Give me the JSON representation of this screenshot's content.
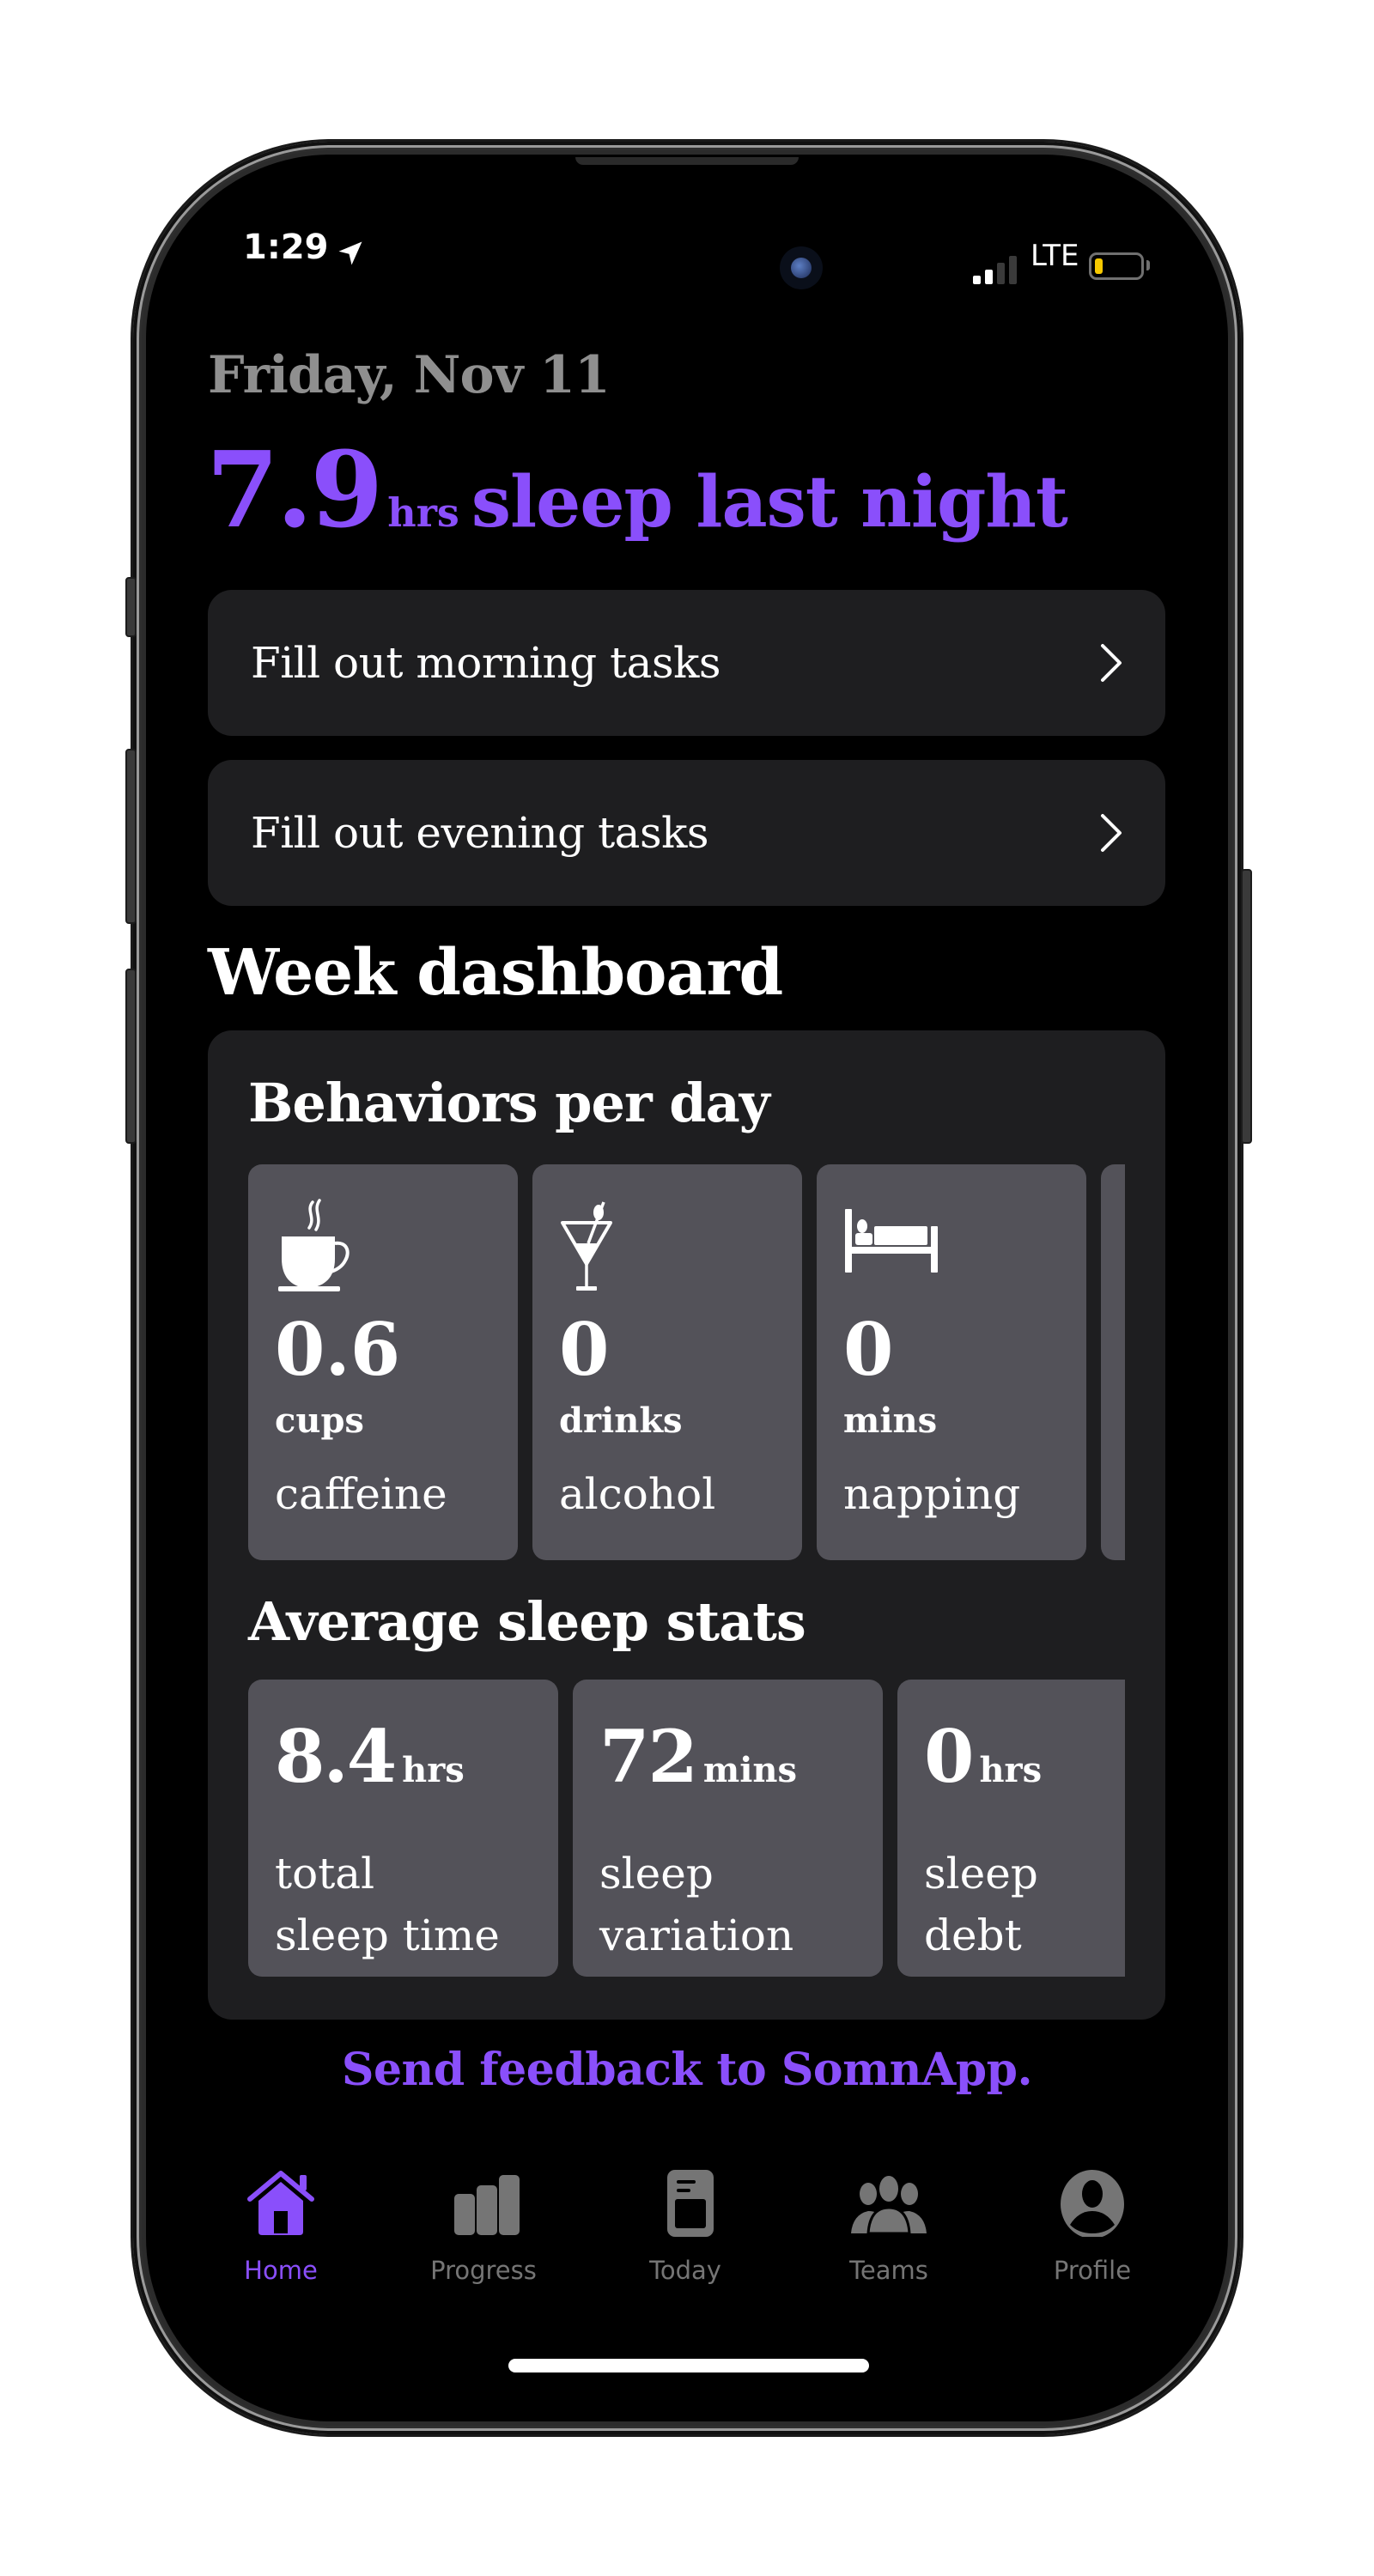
{
  "status_bar": {
    "time": "1:29",
    "network": "LTE",
    "signal_bars_active": 2,
    "signal_bars_total": 4,
    "battery_level": "low",
    "battery_color": "#f7c900"
  },
  "header": {
    "date": "Friday, Nov 11",
    "sleep_value": "7.9",
    "sleep_unit": "hrs",
    "sleep_caption": "sleep last night"
  },
  "tasks": [
    {
      "label": "Fill out morning tasks",
      "icon": "chevron-right-icon"
    },
    {
      "label": "Fill out evening tasks",
      "icon": "chevron-right-icon"
    }
  ],
  "dashboard": {
    "title": "Week dashboard",
    "behaviors": {
      "title": "Behaviors per day",
      "items": [
        {
          "icon": "coffee-cup-icon",
          "value": "0.6",
          "unit": "cups",
          "name": "caffeine"
        },
        {
          "icon": "cocktail-icon",
          "value": "0",
          "unit": "drinks",
          "name": "alcohol"
        },
        {
          "icon": "bed-icon",
          "value": "0",
          "unit": "mins",
          "name": "napping"
        }
      ]
    },
    "sleep_stats": {
      "title": "Average sleep stats",
      "items": [
        {
          "value": "8.4",
          "unit": "hrs",
          "line1": "total",
          "line2": "sleep time"
        },
        {
          "value": "72",
          "unit": "mins",
          "line1": "sleep",
          "line2": "variation"
        },
        {
          "value": "0",
          "unit": "hrs",
          "line1": "sleep",
          "line2": "debt"
        }
      ]
    }
  },
  "feedback_link": "Send feedback to SomnApp.",
  "tabbar": {
    "active": "Home",
    "items": [
      {
        "label": "Home",
        "icon": "house-icon"
      },
      {
        "label": "Progress",
        "icon": "bar-chart-icon"
      },
      {
        "label": "Today",
        "icon": "journal-icon"
      },
      {
        "label": "Teams",
        "icon": "people-icon"
      },
      {
        "label": "Profile",
        "icon": "person-circle-icon"
      }
    ]
  },
  "colors": {
    "accent": "#8a4ffb",
    "background": "#000000",
    "card": "#1e1e20",
    "tile": "#535259",
    "date_gray": "#8f8f8f",
    "inactive_tab": "#757575"
  }
}
